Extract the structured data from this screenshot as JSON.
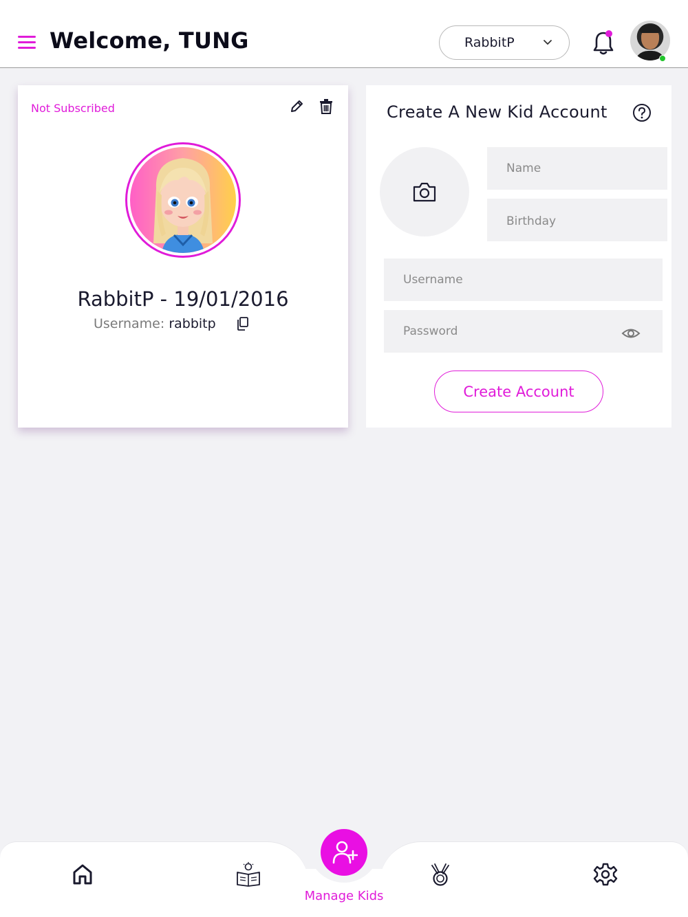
{
  "header": {
    "welcome": "Welcome, TUNG",
    "kid_selector": "RabbitP"
  },
  "kid_card": {
    "status": "Not Subscribed",
    "name_line": "RabbitP  - 19/01/2016",
    "username_label": "Username:",
    "username_value": "rabbitp"
  },
  "create_form": {
    "title": "Create A New Kid Account",
    "name_placeholder": "Name",
    "birthday_placeholder": "Birthday",
    "username_placeholder": "Username",
    "password_placeholder": "Password",
    "submit_label": "Create Account"
  },
  "bottom_nav": {
    "active_label": "Manage Kids",
    "items": [
      "home-icon",
      "lesson-book-icon",
      "manage-kids-icon",
      "medal-icon",
      "settings-icon"
    ]
  },
  "colors": {
    "accent": "#e01bd9",
    "background": "#f2f2f5",
    "field_bg": "#f1f1f3",
    "online": "#22c42c"
  }
}
